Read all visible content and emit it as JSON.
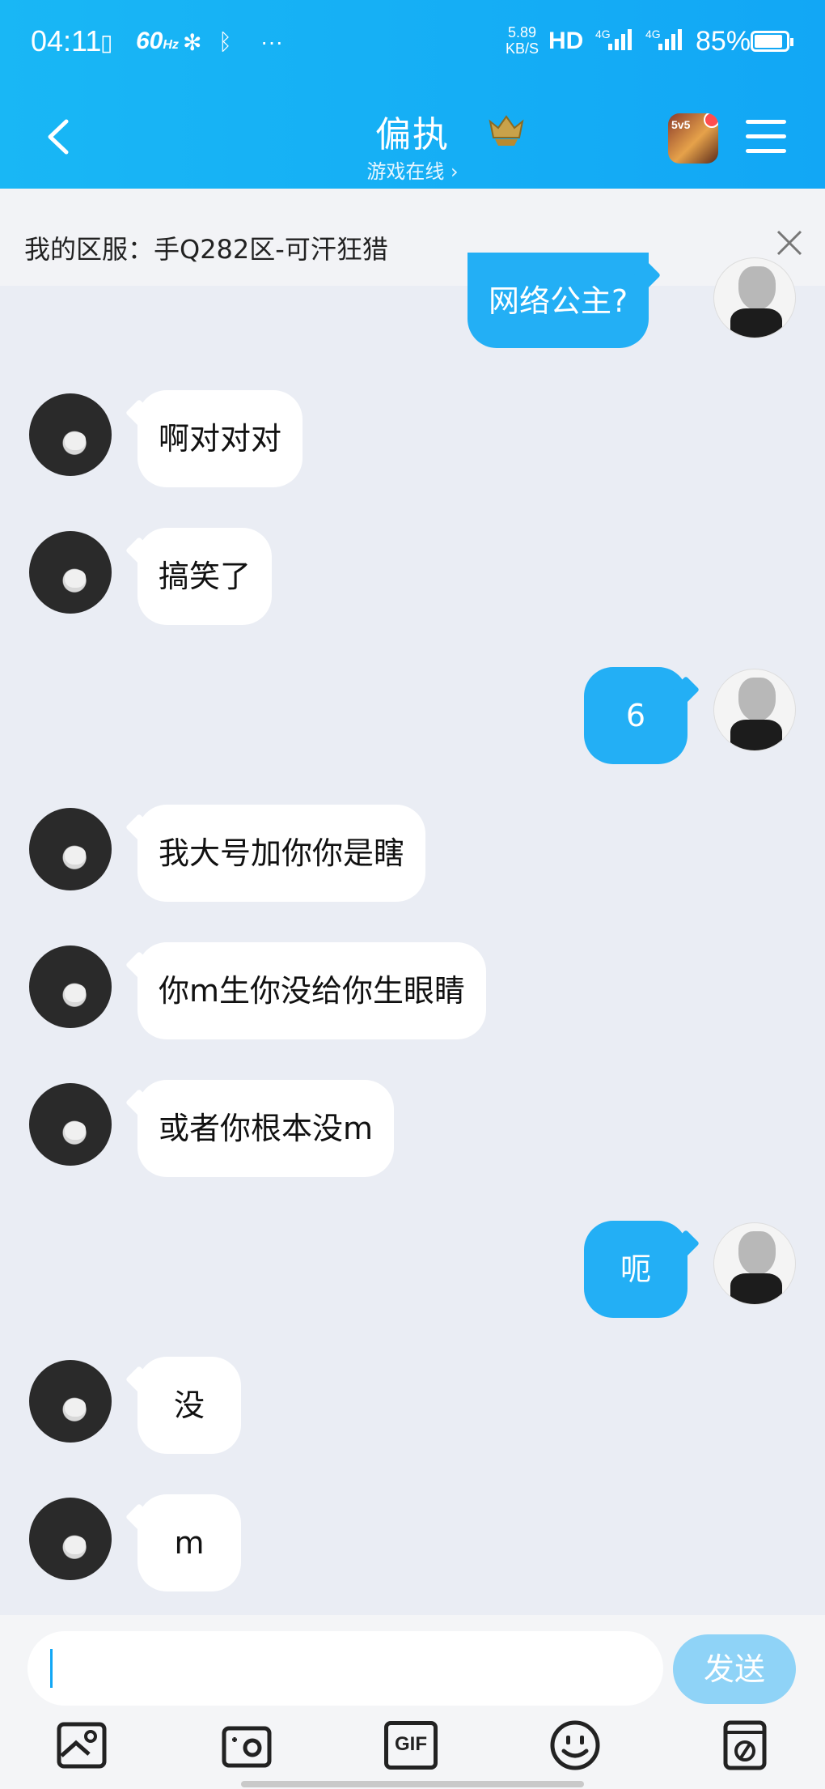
{
  "status_bar": {
    "time": "04:11",
    "refresh_rate": "60",
    "refresh_unit": "Hz",
    "more": "···",
    "net_speed_top": "5.89",
    "net_speed_bottom": "KB/S",
    "hd": "HD",
    "sig1_label": "4G",
    "sig2_label": "4G",
    "battery": "85%"
  },
  "header": {
    "title": "偏执",
    "subtitle": "游戏在线 ›",
    "game_badge": "5v5"
  },
  "server_banner": {
    "text": "我的区服：手Q282区-可汗狂猎"
  },
  "messages": [
    {
      "side": "me",
      "text": "网络公主?"
    },
    {
      "side": "them",
      "text": "啊对对对"
    },
    {
      "side": "them",
      "text": "搞笑了"
    },
    {
      "side": "me",
      "text": "6"
    },
    {
      "side": "them",
      "text": "我大号加你你是瞎"
    },
    {
      "side": "them",
      "text": "你m生你没给你生眼睛"
    },
    {
      "side": "them",
      "text": "或者你根本没m"
    },
    {
      "side": "me",
      "text": "呃"
    },
    {
      "side": "them",
      "text": "没"
    },
    {
      "side": "them",
      "text": "m"
    }
  ],
  "composer": {
    "input_value": "",
    "send_label": "发送",
    "gif_label": "GIF"
  },
  "colors": {
    "header": "#12a7f5",
    "my_bubble": "#23aff5",
    "send_button": "#8fd3f7"
  }
}
